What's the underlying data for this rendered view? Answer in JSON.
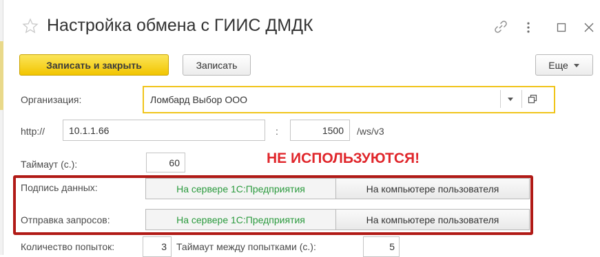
{
  "window": {
    "title": "Настройка обмена с ГИИС ДМДК"
  },
  "icons": {
    "favorite": "star-outline-icon",
    "link": "link-icon",
    "more": "more-vertical-icon",
    "maximize": "maximize-icon",
    "close": "close-icon"
  },
  "toolbar": {
    "save_close_label": "Записать и закрыть",
    "save_label": "Записать",
    "more_label": "Еще"
  },
  "form": {
    "organization_label": "Организация:",
    "organization_value": "Ломбард Выбор ООО",
    "http_label": "http://",
    "host_value": "10.1.1.66",
    "port_sep": ":",
    "port_value": "1500",
    "path_value": "/ws/v3",
    "timeout_label": "Таймаут (с.):",
    "timeout_value": "60",
    "warning": "НЕ ИСПОЛЬЗУЮТСЯ!",
    "sign_label": "Подпись данных:",
    "send_label": "Отправка запросов:",
    "option_server": "На сервере 1С:Предприятия",
    "option_client": "На компьютере пользователя",
    "attempts_label": "Количество попыток:",
    "attempts_value": "3",
    "retry_timeout_label": "Таймаут между попытками (с.):",
    "retry_timeout_value": "5"
  },
  "colors": {
    "accent": "#f2c500",
    "selected_option": "#2a9a3d",
    "warning": "#e0262b",
    "highlight_box": "#b11a16"
  }
}
